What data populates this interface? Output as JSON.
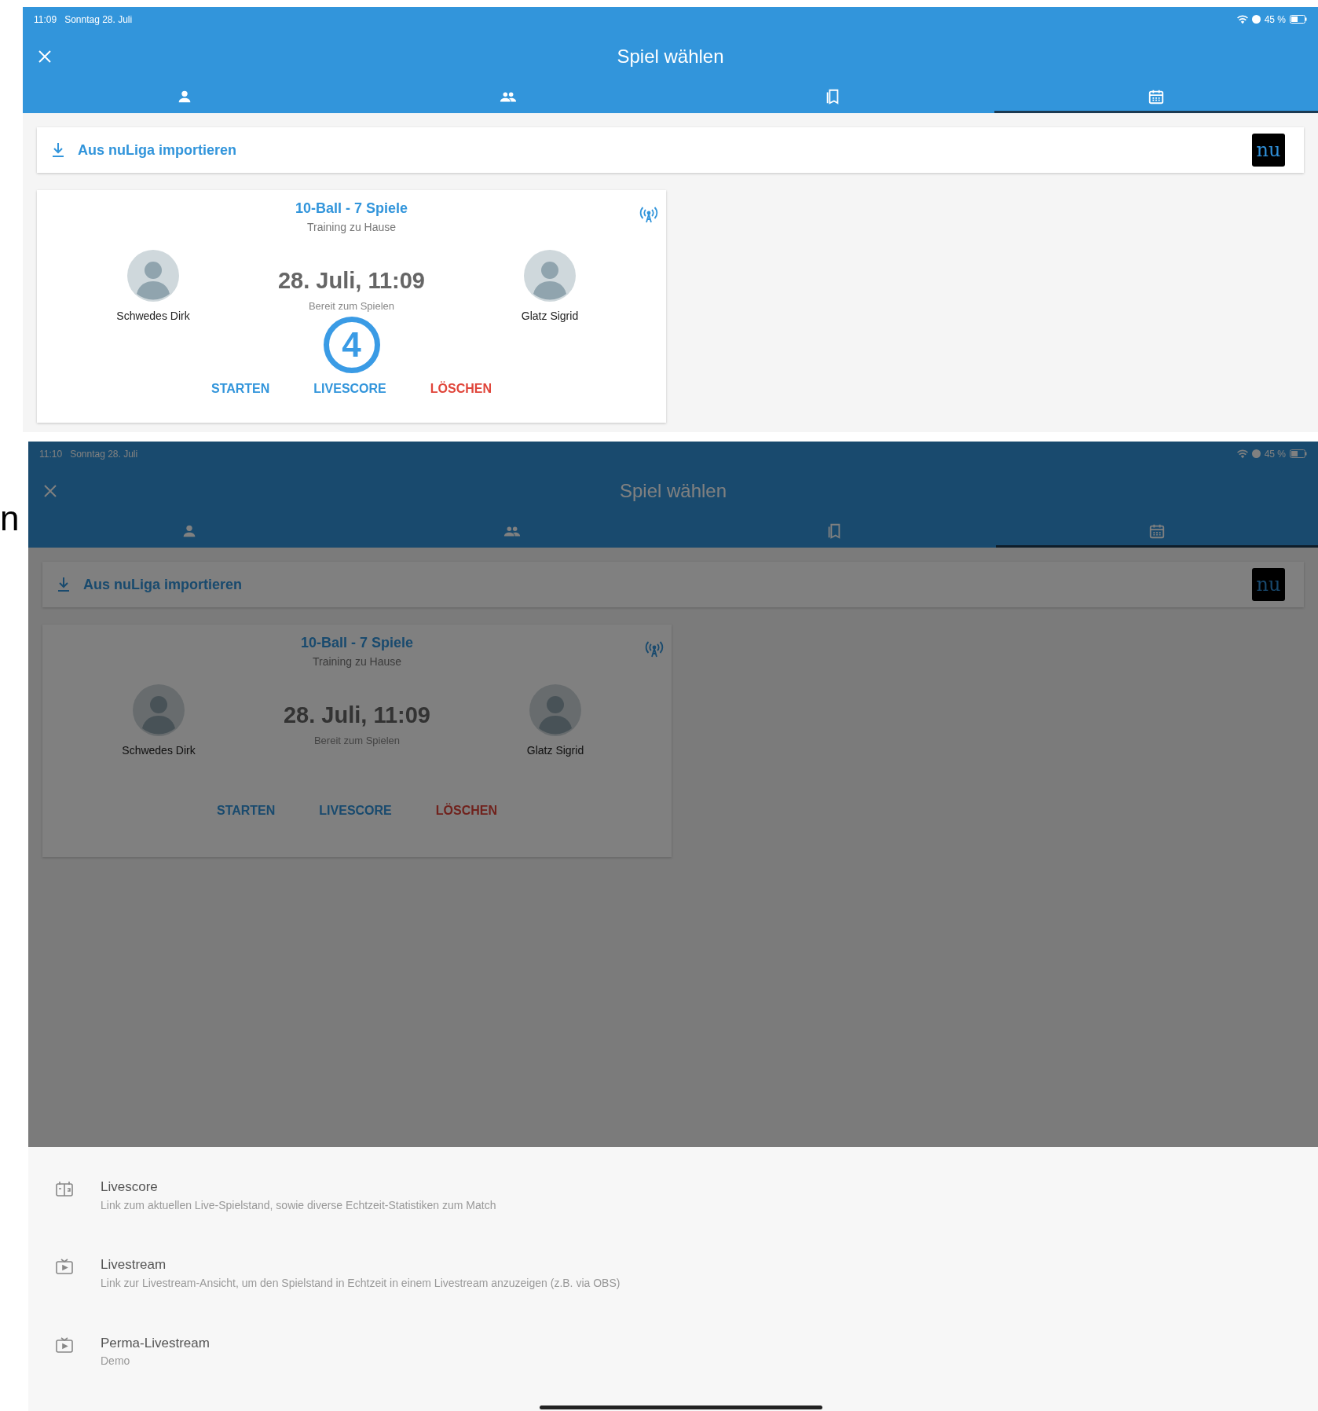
{
  "left_edge_text": "n",
  "screens": [
    {
      "dimmed": false,
      "status_bar": {
        "time": "11:09",
        "date": "Sonntag 28. Juli",
        "battery": "45 %"
      },
      "title": "Spiel wählen",
      "tabs": [
        {
          "kind": "person",
          "selected": false
        },
        {
          "kind": "group",
          "selected": false
        },
        {
          "kind": "bookmarks",
          "selected": false
        },
        {
          "kind": "calendar",
          "selected": true
        }
      ],
      "import_bar": {
        "label": "Aus nuLiga importieren",
        "logo": "nu"
      },
      "match_card": {
        "title": "10-Ball - 7 Spiele",
        "subtitle": "Training zu Hause",
        "player_left": "Schwedes Dirk",
        "player_right": "Glatz Sigrid",
        "datetime": "28. Juli, 11:09",
        "status": "Bereit zum Spielen",
        "actions": [
          {
            "label": "STARTEN",
            "kind": "primary"
          },
          {
            "label": "LIVESCORE",
            "kind": "primary"
          },
          {
            "label": "LÖSCHEN",
            "kind": "danger"
          }
        ]
      },
      "annotation": "4"
    },
    {
      "dimmed": true,
      "status_bar": {
        "time": "11:10",
        "date": "Sonntag 28. Juli",
        "battery": "45 %"
      },
      "title": "Spiel wählen",
      "tabs": [
        {
          "kind": "person",
          "selected": false
        },
        {
          "kind": "group",
          "selected": false
        },
        {
          "kind": "bookmarks",
          "selected": false
        },
        {
          "kind": "calendar",
          "selected": true
        }
      ],
      "import_bar": {
        "label": "Aus nuLiga importieren",
        "logo": "nu"
      },
      "match_card": {
        "title": "10-Ball - 7 Spiele",
        "subtitle": "Training zu Hause",
        "player_left": "Schwedes Dirk",
        "player_right": "Glatz Sigrid",
        "datetime": "28. Juli, 11:09",
        "status": "Bereit zum Spielen",
        "actions": [
          {
            "label": "STARTEN",
            "kind": "primary"
          },
          {
            "label": "LIVESCORE",
            "kind": "primary"
          },
          {
            "label": "LÖSCHEN",
            "kind": "danger"
          }
        ]
      },
      "bottom_sheet": [
        {
          "kind": "scoreboard",
          "title": "Livescore",
          "description": "Link zum aktuellen Live-Spielstand, sowie diverse Echtzeit-Statistiken zum Match"
        },
        {
          "kind": "play",
          "title": "Livestream",
          "description": "Link zur Livestream-Ansicht, um den Spielstand in Echtzeit in einem Livestream anzuzeigen (z.B. via OBS)"
        },
        {
          "kind": "play",
          "title": "Perma-Livestream",
          "description": "Demo"
        }
      ]
    }
  ]
}
